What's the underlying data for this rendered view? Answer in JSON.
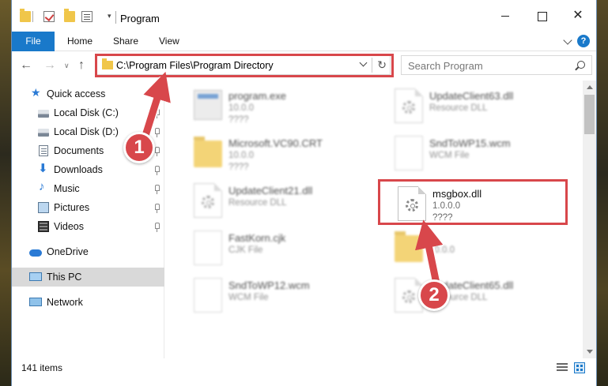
{
  "window": {
    "title": "Program",
    "quick_access_dropdown": "▾",
    "controls": {
      "close": "✕"
    }
  },
  "ribbon": {
    "tabs": [
      "File",
      "Home",
      "Share",
      "View"
    ],
    "help": "?"
  },
  "nav": {
    "back": "←",
    "forward": "→",
    "recent": "∨",
    "up": "↑",
    "address": "C:\\Program Files\\Program Directory",
    "refresh": "↻",
    "search_placeholder": "Search Program"
  },
  "sidebar": {
    "quick_access": "Quick access",
    "items": [
      {
        "label": "Local Disk (C:)",
        "icon": "drive-icon",
        "pinned": true
      },
      {
        "label": "Local Disk (D:)",
        "icon": "drive-icon",
        "pinned": true
      },
      {
        "label": "Documents",
        "icon": "documents-icon",
        "pinned": true
      },
      {
        "label": "Downloads",
        "icon": "downloads-icon",
        "pinned": true
      },
      {
        "label": "Music",
        "icon": "music-icon",
        "pinned": true
      },
      {
        "label": "Pictures",
        "icon": "pictures-icon",
        "pinned": true
      },
      {
        "label": "Videos",
        "icon": "videos-icon",
        "pinned": true
      }
    ],
    "onedrive": "OneDrive",
    "this_pc": "This PC",
    "network": "Network"
  },
  "files": [
    {
      "name": "program.exe",
      "line2": "10.0.0",
      "line3": "????",
      "type": "exe",
      "blurred": true
    },
    {
      "name": "UpdateClient63.dll",
      "line2": "Resource DLL",
      "line3": "",
      "type": "dll",
      "blurred": true
    },
    {
      "name": "Microsoft.VC90.CRT",
      "line2": "10.0.0",
      "line3": "????",
      "type": "folder",
      "blurred": true
    },
    {
      "name": "SndToWP15.wcm",
      "line2": "WCM File",
      "line3": "",
      "type": "doc",
      "blurred": true
    },
    {
      "name": "UpdateClient21.dll",
      "line2": "Resource DLL",
      "line3": "",
      "type": "dll",
      "blurred": true
    },
    {
      "name": "msgbox.dll",
      "line2": "1.0.0.0",
      "line3": "????",
      "type": "dll",
      "blurred": false
    },
    {
      "name": "FastKorn.cjk",
      "line2": "CJK File",
      "line3": "",
      "type": "doc",
      "blurred": true
    },
    {
      "name": "",
      "line2": "10.0.0",
      "line3": "",
      "type": "folder",
      "blurred": true
    },
    {
      "name": "SndToWP12.wcm",
      "line2": "WCM File",
      "line3": "",
      "type": "doc",
      "blurred": true
    },
    {
      "name": "UpdateClient65.dll",
      "line2": "Resource DLL",
      "line3": "",
      "type": "dll",
      "blurred": true
    }
  ],
  "status": {
    "item_count": "141 items"
  },
  "annotations": {
    "badge1": "1",
    "badge2": "2",
    "color": "#d8474b"
  },
  "colors": {
    "accent": "#1979ca",
    "folder": "#f0c64a"
  }
}
